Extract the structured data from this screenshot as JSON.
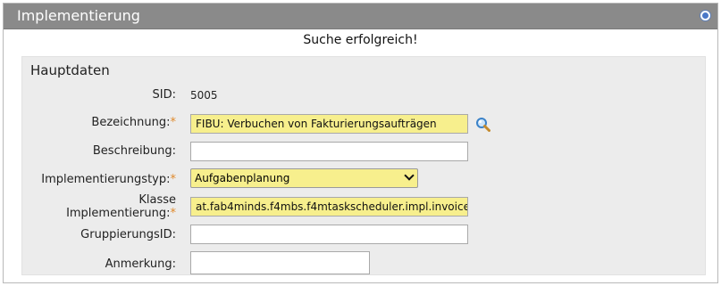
{
  "panel": {
    "title": "Implementierung",
    "message": "Suche erfolgreich!"
  },
  "group": {
    "title": "Hauptdaten"
  },
  "fields": {
    "sid_label": "SID:",
    "sid_value": "5005",
    "bezeichnung_label": "Bezeichnung:",
    "bezeichnung_value": "FIBU: Verbuchen von Fakturierungsaufträgen",
    "beschreibung_label": "Beschreibung:",
    "beschreibung_value": "",
    "typ_label": "Implementierungstyp:",
    "typ_value": "Aufgabenplanung",
    "klasse_label_1": "Klasse",
    "klasse_label_2": "Implementierung:",
    "klasse_value": "at.fab4minds.f4mbs.f4mtaskscheduler.impl.invoice",
    "gruppierung_label": "GruppierungsID:",
    "gruppierung_value": "",
    "anmerkung_label": "Anmerkung:",
    "anmerkung_value": "",
    "required_marker": "*"
  },
  "colors": {
    "title_bar": "#8a8a8a",
    "required": "#e08a2c",
    "mandatory_field": "#f7ef8d"
  },
  "icons": {
    "collapse": "collapse-icon",
    "search": "search-icon"
  }
}
